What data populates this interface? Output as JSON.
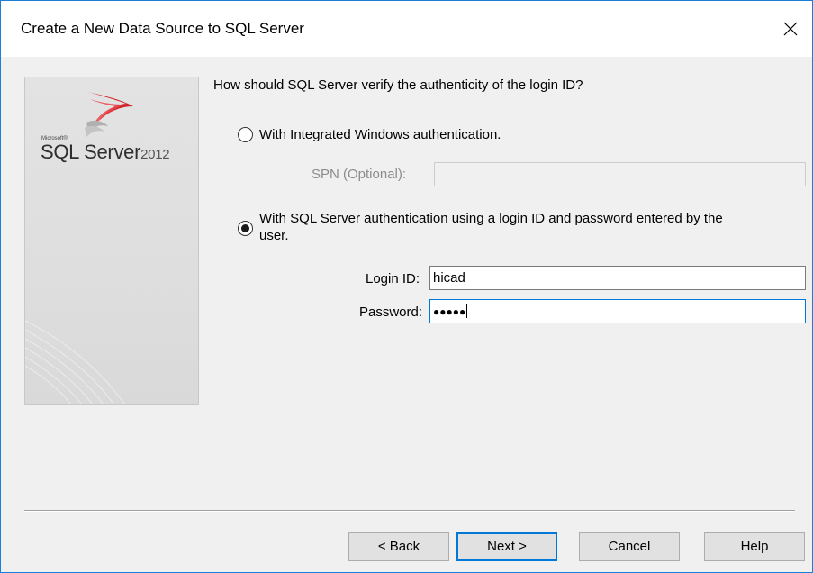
{
  "window": {
    "title": "Create a New Data Source to SQL Server"
  },
  "icons": {
    "close": "close-x-icon",
    "logo": "sql-server-logo"
  },
  "banner": {
    "brand_small": "Microsoft®",
    "product": "SQL Server",
    "version": "2012"
  },
  "auth": {
    "question": "How should SQL Server verify the authenticity of the login ID?",
    "options": [
      {
        "label": "With Integrated Windows authentication.",
        "selected": false
      },
      {
        "label": "With SQL Server authentication using a login ID and password entered by the",
        "label_cont": "user.",
        "selected": true
      }
    ],
    "spn": {
      "label": "SPN (Optional):",
      "value": "",
      "enabled": false
    },
    "login_id": {
      "label": "Login ID:",
      "value": "hicad"
    },
    "password": {
      "label": "Password:",
      "value": "●●●●●"
    }
  },
  "buttons": {
    "back": "< Back",
    "next": "Next >",
    "cancel": "Cancel",
    "help": "Help"
  },
  "colors": {
    "accent": "#0078d7",
    "logo_red": "#d0242b"
  }
}
